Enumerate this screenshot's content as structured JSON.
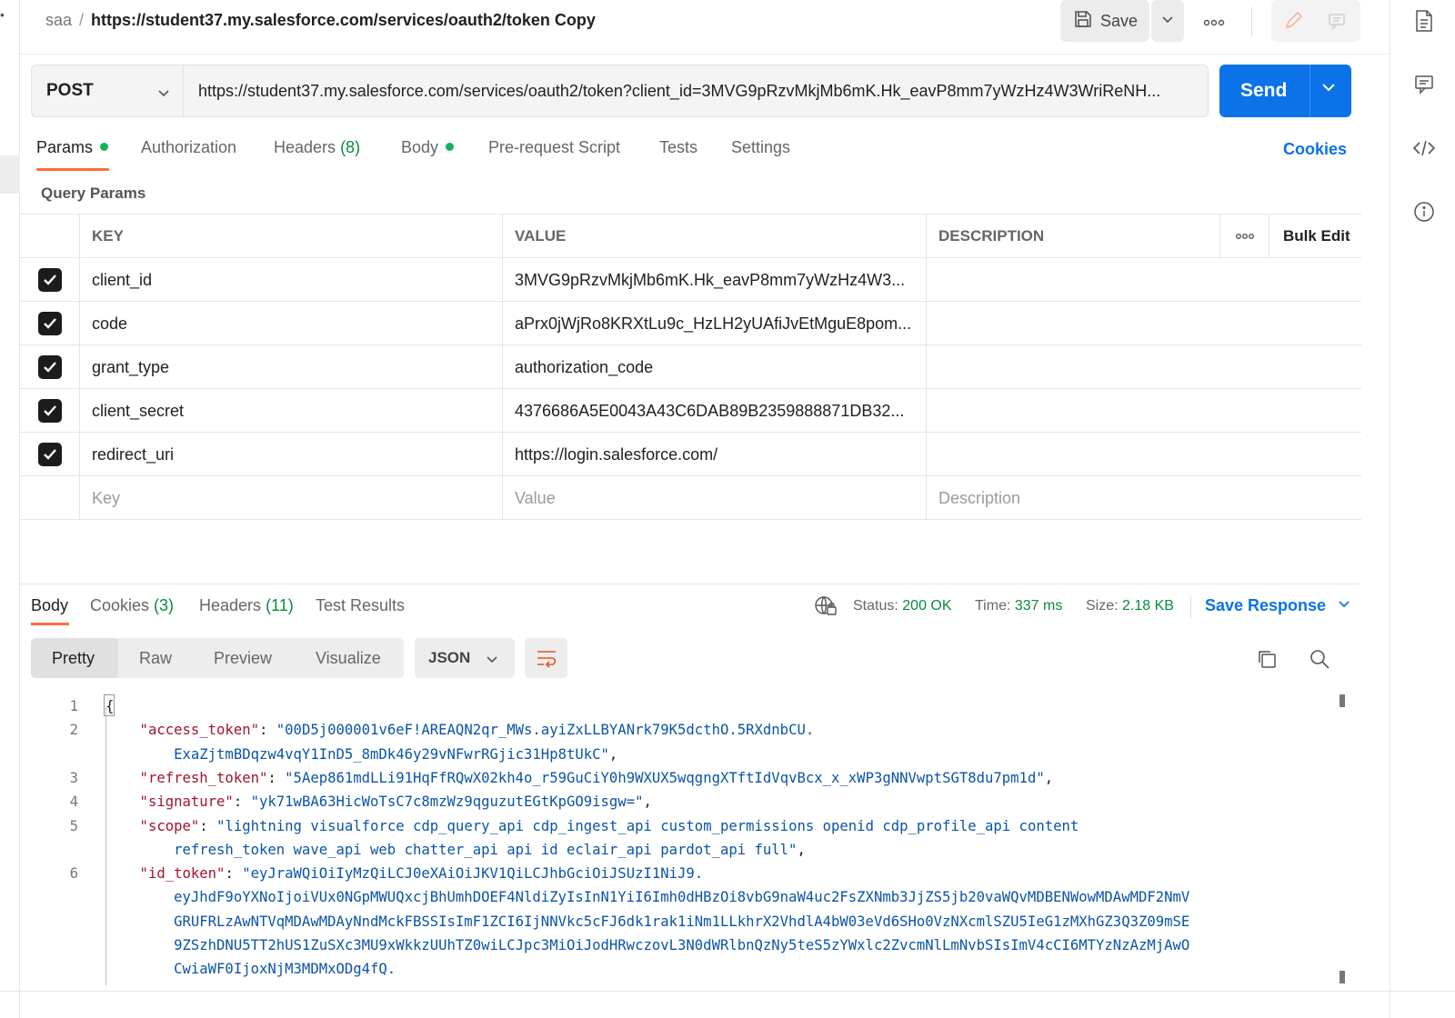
{
  "breadcrumb": {
    "collection": "saa",
    "separator": "/",
    "request_name": "https://student37.my.salesforce.com/services/oauth2/token Copy"
  },
  "header": {
    "save_label": "Save",
    "icons": [
      "save-icon",
      "chevron-down-icon",
      "more-icon",
      "edit-icon",
      "comment-icon"
    ]
  },
  "right_sidebar": {
    "icons": [
      "documentation-icon",
      "comments-icon",
      "code-icon",
      "info-icon"
    ]
  },
  "request": {
    "method": "POST",
    "url": "https://student37.my.salesforce.com/services/oauth2/token?client_id=3MVG9pRzvMkjMb6mK.Hk_eavP8mm7yWzHz4W3WriReNH...",
    "send_label": "Send"
  },
  "request_tabs": [
    {
      "label": "Params",
      "dot": true
    },
    {
      "label": "Authorization"
    },
    {
      "label": "Headers",
      "count": "(8)"
    },
    {
      "label": "Body",
      "dot": true
    },
    {
      "label": "Pre-request Script"
    },
    {
      "label": "Tests"
    },
    {
      "label": "Settings"
    }
  ],
  "cookies_link": "Cookies",
  "query_params_title": "Query Params",
  "params_table": {
    "headers": [
      "KEY",
      "VALUE",
      "DESCRIPTION",
      "Bulk Edit"
    ],
    "rows": [
      {
        "checked": true,
        "key": "client_id",
        "value": "3MVG9pRzvMkjMb6mK.Hk_eavP8mm7yWzHz4W3...",
        "description": ""
      },
      {
        "checked": true,
        "key": "code",
        "value": "aPrx0jWjRo8KRXtLu9c_HzLH2yUAfiJvEtMguE8pom...",
        "description": ""
      },
      {
        "checked": true,
        "key": "grant_type",
        "value": "authorization_code",
        "description": ""
      },
      {
        "checked": true,
        "key": "client_secret",
        "value": "4376686A5E0043A43C6DAB89B2359888871DB32...",
        "description": ""
      },
      {
        "checked": true,
        "key": "redirect_uri",
        "value": "https://login.salesforce.com/",
        "description": ""
      }
    ],
    "placeholders": {
      "key": "Key",
      "value": "Value",
      "description": "Description"
    }
  },
  "response_tabs": [
    {
      "label": "Body"
    },
    {
      "label": "Cookies",
      "count": "(3)"
    },
    {
      "label": "Headers",
      "count": "(11)"
    },
    {
      "label": "Test Results"
    }
  ],
  "response_status": {
    "status_label": "Status:",
    "status_value": "200 OK",
    "time_label": "Time:",
    "time_value": "337 ms",
    "size_label": "Size:",
    "size_value": "2.18 KB",
    "save_response": "Save Response"
  },
  "view_modes": [
    "Pretty",
    "Raw",
    "Preview",
    "Visualize"
  ],
  "active_view": "Pretty",
  "format": "JSON",
  "code_lines": [
    {
      "n": "1",
      "parts": [
        [
          "punc",
          "{"
        ]
      ]
    },
    {
      "n": "2",
      "parts": [
        [
          "key",
          "    \"access_token\""
        ],
        [
          "punc",
          ": "
        ],
        [
          "str",
          "\"00D5j000001v6eF!AREAQN2qr_MWs.ayiZxLLBYANrk79K5dcthO.5RXdnbCU."
        ]
      ]
    },
    {
      "n": "",
      "parts": [
        [
          "str",
          "        ExaZjtmBDqzw4vqY1InD5_8mDk46y29vNFwrRGjic31Hp8tUkC\""
        ],
        [
          "punc",
          ","
        ]
      ]
    },
    {
      "n": "3",
      "parts": [
        [
          "key",
          "    \"refresh_token\""
        ],
        [
          "punc",
          ": "
        ],
        [
          "str",
          "\"5Aep861mdLLi91HqFfRQwX02kh4o_r59GuCiY0h9WXUX5wqgngXTftIdVqvBcx_x_xWP3gNNVwptSGT8du7pm1d\""
        ],
        [
          "punc",
          ","
        ]
      ]
    },
    {
      "n": "4",
      "parts": [
        [
          "key",
          "    \"signature\""
        ],
        [
          "punc",
          ": "
        ],
        [
          "str",
          "\"yk71wBA63HicWoTsC7c8mzWz9qguzutEGtKpGO9isgw=\""
        ],
        [
          "punc",
          ","
        ]
      ]
    },
    {
      "n": "5",
      "parts": [
        [
          "key",
          "    \"scope\""
        ],
        [
          "punc",
          ": "
        ],
        [
          "str",
          "\"lightning visualforce cdp_query_api cdp_ingest_api custom_permissions openid cdp_profile_api content"
        ]
      ]
    },
    {
      "n": "",
      "parts": [
        [
          "str",
          "        refresh_token wave_api web chatter_api api id eclair_api pardot_api full\""
        ],
        [
          "punc",
          ","
        ]
      ]
    },
    {
      "n": "6",
      "parts": [
        [
          "key",
          "    \"id_token\""
        ],
        [
          "punc",
          ": "
        ],
        [
          "str",
          "\"eyJraWQiOiIyMzQiLCJ0eXAiOiJKV1QiLCJhbGciOiJSUzI1NiJ9."
        ]
      ]
    },
    {
      "n": "",
      "parts": [
        [
          "str",
          "        eyJhdF9oYXNoIjoiVUx0NGpMWUQxcjBhUmhDOEF4NldiZyIsInN1YiI6Imh0dHBzOi8vbG9naW4uc2FsZXNmb3JjZS5jb20vaWQvMDBENWowMDAwMDF2NmV"
        ]
      ]
    },
    {
      "n": "",
      "parts": [
        [
          "str",
          "        GRUFRLzAwNTVqMDAwMDAyNndMckFBSSIsImF1ZCI6IjNNVkc5cFJ6dk1rak1iNm1LLkhrX2VhdlA4bW03eVd6SHo0VzNXcmlSZU5IeG1zMXhGZ3Q3Z09mSE"
        ]
      ]
    },
    {
      "n": "",
      "parts": [
        [
          "str",
          "        9ZSzhDNU5TT2hUS1ZuSXc3MU9xWkkzUUhTZ0wiLCJpc3MiOiJodHRwczovL3N0dWRlbnQzNy5teS5zYWxlc2ZvcmNlLmNvbSIsImV4cCI6MTYzNzAzMjAwO"
        ]
      ]
    },
    {
      "n": "",
      "parts": [
        [
          "str",
          "        CwiaWF0IjoxNjM3MDMxODg4fQ."
        ]
      ]
    }
  ]
}
